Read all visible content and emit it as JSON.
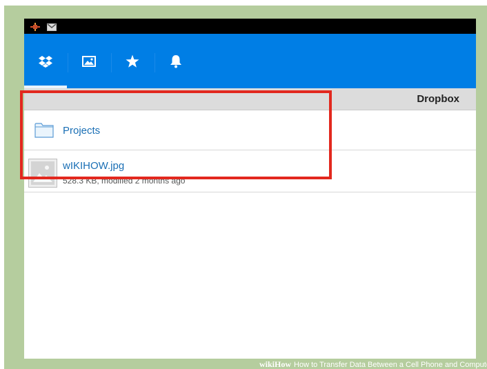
{
  "statusbar": {
    "icons": [
      "tool-icon",
      "gmail-icon"
    ]
  },
  "toolbar": {
    "tabs": [
      {
        "icon": "dropbox-icon",
        "active": true
      },
      {
        "icon": "photos-icon",
        "active": false
      },
      {
        "icon": "star-icon",
        "active": false
      },
      {
        "icon": "bell-icon",
        "active": false
      }
    ]
  },
  "pathbar": {
    "title": "Dropbox"
  },
  "files": [
    {
      "type": "folder",
      "name": "Projects",
      "icon": "folder-icon"
    },
    {
      "type": "file",
      "name": "wIKIHOW.jpg",
      "details": "528.3 KB, modified 2 months ago",
      "icon": "image-thumbnail-icon"
    }
  ],
  "watermark": {
    "brand": "wikiHow",
    "text": "How to Transfer Data Between a Cell Phone and Compute"
  },
  "colors": {
    "accent": "#007ee5",
    "highlight": "#e2281e",
    "link": "#1a6fb5",
    "frame": "#b5cd9e"
  }
}
